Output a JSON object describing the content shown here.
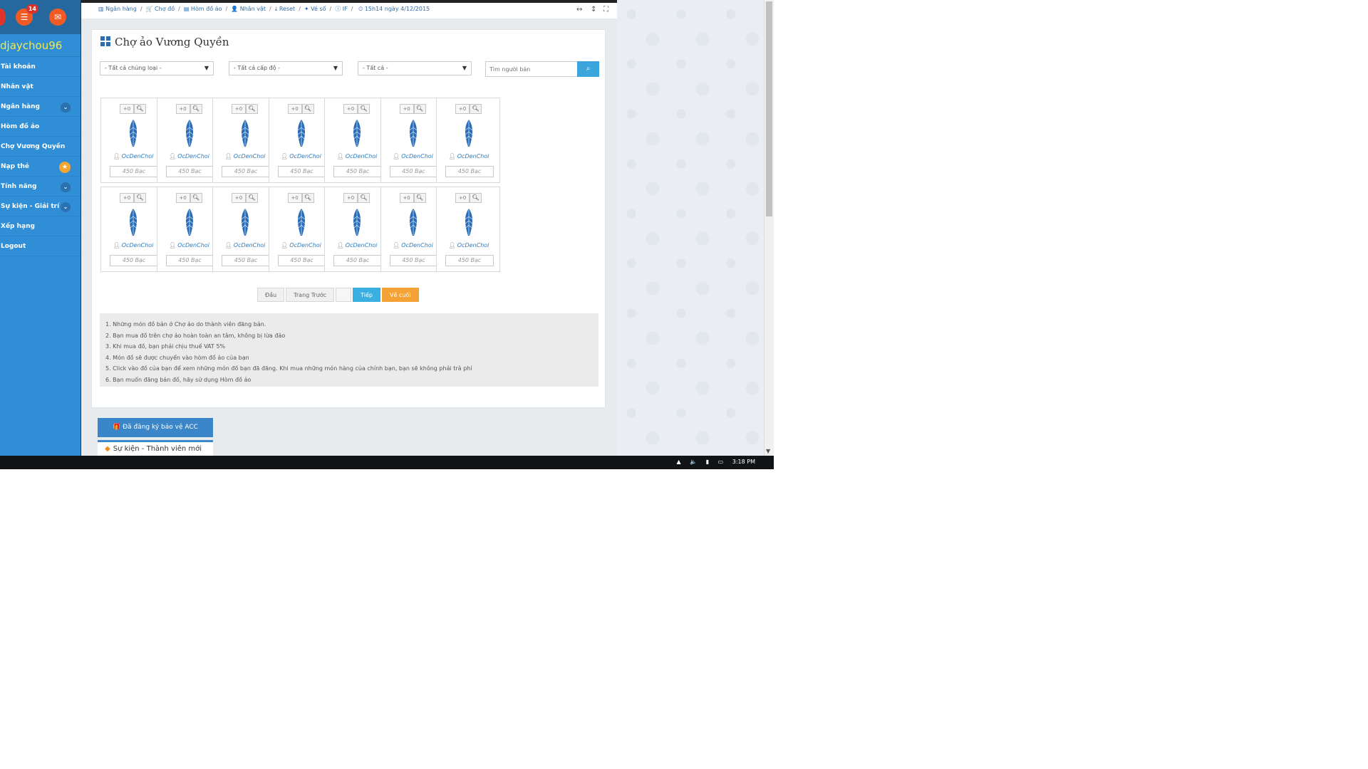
{
  "sidebar": {
    "notif_count": "14",
    "username": "djaychou96",
    "items": [
      {
        "label": "Tài khoản",
        "extra": ""
      },
      {
        "label": "Nhân vật",
        "extra": ""
      },
      {
        "label": "Ngân hàng",
        "extra": "chevron"
      },
      {
        "label": "Hòm đồ ảo",
        "extra": ""
      },
      {
        "label": "Chợ Vương Quyền",
        "extra": ""
      },
      {
        "label": "Nạp thẻ",
        "extra": "star"
      },
      {
        "label": "Tính năng",
        "extra": "chevron"
      },
      {
        "label": "Sự kiện - Giải trí",
        "extra": "chevron"
      },
      {
        "label": "Xếp hạng",
        "extra": ""
      },
      {
        "label": "Logout",
        "extra": ""
      }
    ]
  },
  "breadcrumb": {
    "items": [
      "Ngân hàng",
      "Chợ đồ",
      "Hòm đồ ảo",
      "Nhân vật",
      "Reset",
      "Vé số",
      "IF"
    ],
    "time": "15h14 ngày 4/12/2015"
  },
  "main": {
    "title": "Chợ ảo Vương Quyền",
    "filters": [
      "- Tất cả chủng loại -",
      "- Tất cả cấp độ -",
      "- Tất cả -"
    ],
    "search_placeholder": "Tìm người bán",
    "items": [
      {
        "qty": "+0",
        "seller": "OcDenChoi",
        "price": "450 Bạc"
      },
      {
        "qty": "+0",
        "seller": "OcDenChoi",
        "price": "450 Bạc"
      },
      {
        "qty": "+0",
        "seller": "OcDenChoi",
        "price": "450 Bạc"
      },
      {
        "qty": "+0",
        "seller": "OcDenChoi",
        "price": "450 Bạc"
      },
      {
        "qty": "+0",
        "seller": "OcDenChoi",
        "price": "450 Bạc"
      },
      {
        "qty": "+0",
        "seller": "OcDenChoi",
        "price": "450 Bạc"
      },
      {
        "qty": "+0",
        "seller": "OcDenChoi",
        "price": "450 Bạc"
      },
      {
        "qty": "+0",
        "seller": "OcDenChoi",
        "price": "450 Bạc"
      },
      {
        "qty": "+0",
        "seller": "OcDenChoi",
        "price": "450 Bạc"
      },
      {
        "qty": "+0",
        "seller": "OcDenChoi",
        "price": "450 Bạc"
      },
      {
        "qty": "+0",
        "seller": "OcDenChoi",
        "price": "450 Bạc"
      },
      {
        "qty": "+0",
        "seller": "OcDenChoi",
        "price": "450 Bạc"
      },
      {
        "qty": "+0",
        "seller": "OcDenChoi",
        "price": "450 Bạc"
      },
      {
        "qty": "+0",
        "seller": "OcDenChoi",
        "price": "450 Bạc"
      }
    ],
    "pager": {
      "first": "Đầu",
      "prev": "Trang Trước",
      "next": "Tiếp",
      "last": "Về cuối"
    },
    "notes": [
      "1. Những món đồ bán ở Chợ ảo do thành viên đăng bán.",
      "2. Bạn mua đồ trên chợ ảo hoàn toàn an tâm, không bị lừa đảo",
      "3. Khi mua đồ, bạn phải chịu thuế VAT 5%",
      "4. Món đồ sẽ được chuyển vào hòm đồ ảo của bạn",
      "5. Click vào đồ của bạn để xem những món đồ bạn đã đăng. Khi mua những món hàng của chính bạn, bạn sẽ không phải trả phí",
      "6. Bạn muốn đăng bán đồ, hãy sử dụng Hòm đồ ảo"
    ]
  },
  "footer_buttons": {
    "register": "Đã đăng ký bảo vệ ACC",
    "event": "Sự kiện - Thành viên mới"
  },
  "taskbar": {
    "clock": "3:18 PM"
  },
  "colors": {
    "sidebar": "#2f8ed6",
    "accent_blue": "#3ab0e2",
    "accent_orange": "#f4a236",
    "username": "#f6e84a"
  }
}
